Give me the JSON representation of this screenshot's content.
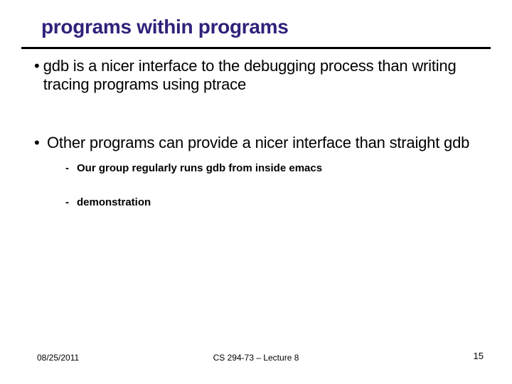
{
  "title": "programs within programs",
  "bullets": [
    {
      "text": "gdb is a nicer interface to the debugging process than writing tracing programs using ptrace"
    },
    {
      "text": "Other programs can provide a nicer interface than straight gdb",
      "subs": [
        "Our group regularly runs gdb from inside emacs",
        "demonstration"
      ]
    }
  ],
  "footer": {
    "date": "08/25/2011",
    "course": "CS 294-73 – Lecture 8",
    "page": "15"
  }
}
